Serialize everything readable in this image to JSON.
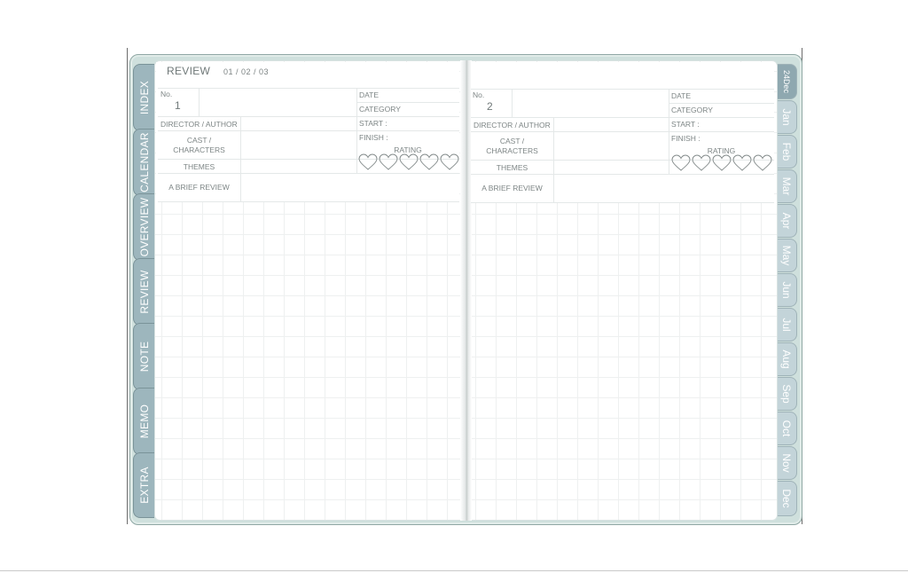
{
  "left_tabs": [
    "INDEX",
    "CALENDAR",
    "OVERVIEW",
    "REVIEW",
    "NOTE",
    "MEMO",
    "EXTRA"
  ],
  "right_tabs": [
    "24Dec",
    "Jan",
    "Feb",
    "Mar",
    "Apr",
    "May",
    "Jun",
    "Jul",
    "Aug",
    "Sep",
    "Oct",
    "Nov",
    "Dec"
  ],
  "header": {
    "title": "REVIEW",
    "date": "01 / 02 / 03"
  },
  "labels": {
    "no": "No.",
    "director": "DIRECTOR / AUTHOR",
    "cast": "CAST /",
    "characters": "CHARACTERS",
    "themes": "THEMES",
    "brief": "A BRIEF REVIEW",
    "date": "DATE",
    "category": "CATEGORY",
    "start": "START :",
    "finish": "FINISH :",
    "rating": "RATING"
  },
  "pages": [
    {
      "number": "1",
      "rating_hearts": 5
    },
    {
      "number": "2",
      "rating_hearts": 5
    }
  ],
  "colors": {
    "cover": "#cfe0dd",
    "tab_left": "#9db6bd",
    "tab_right": "#c3d4d9",
    "tab_active": "#8fa8b0"
  }
}
